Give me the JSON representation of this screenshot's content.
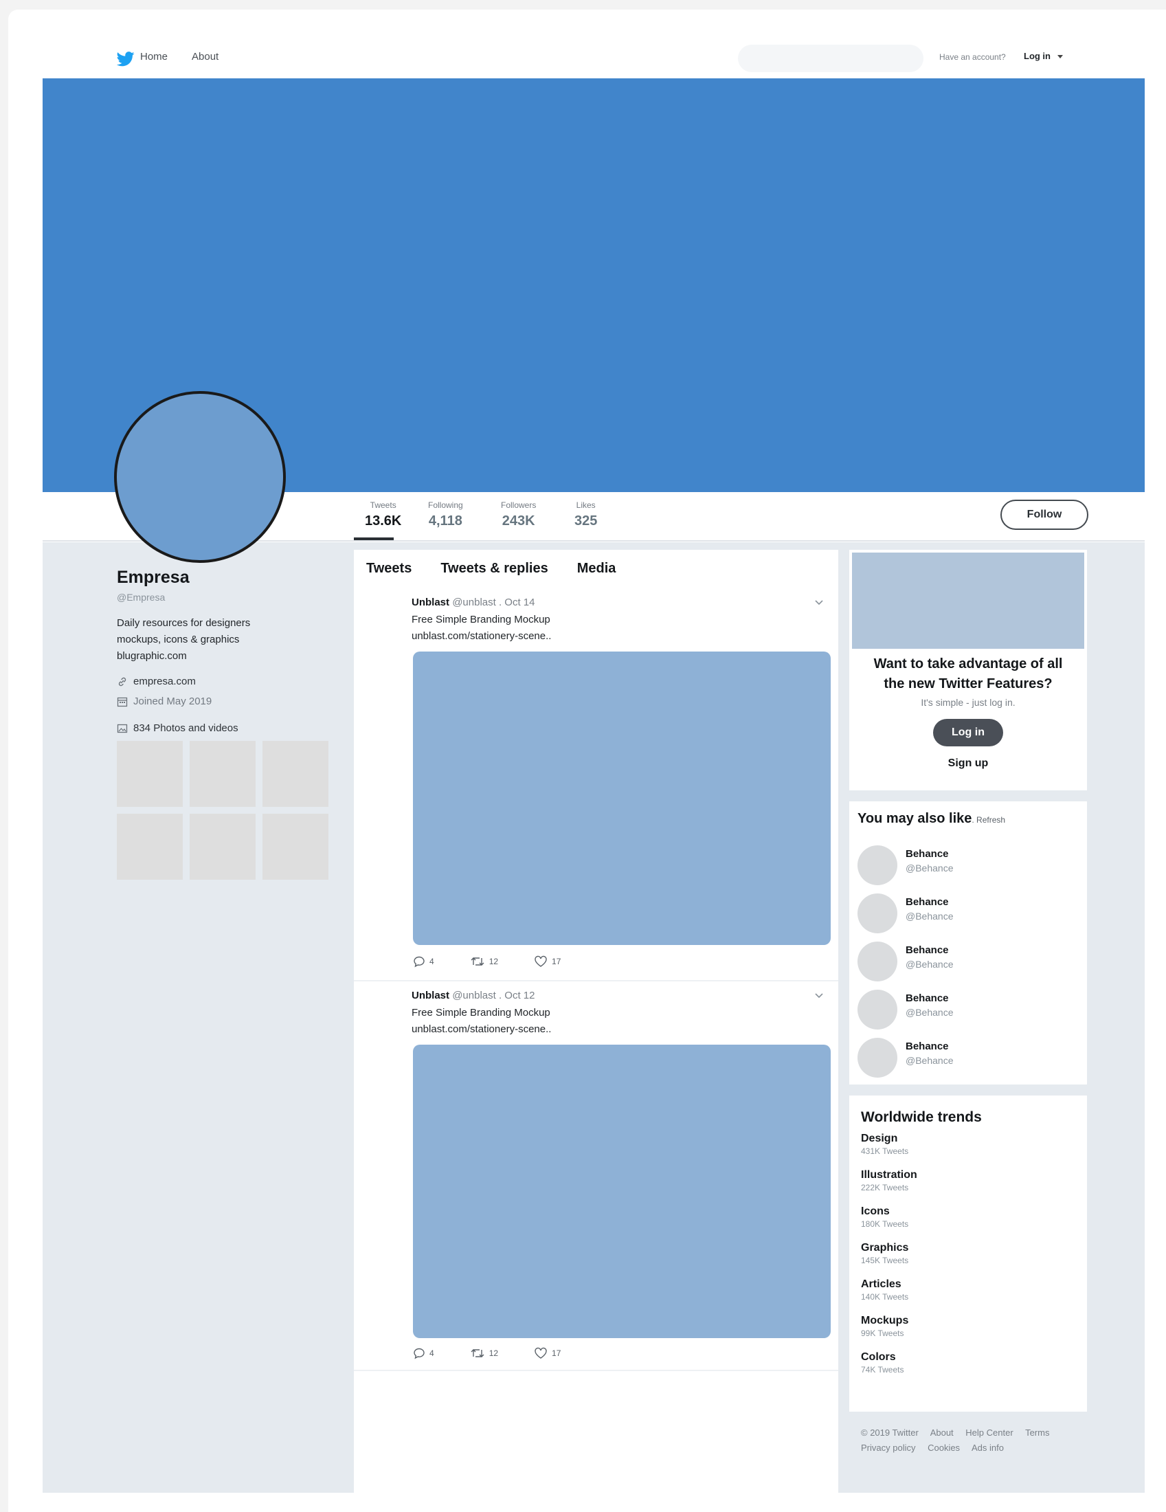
{
  "nav": {
    "home": "Home",
    "about": "About",
    "have_account": "Have an account?",
    "login": "Log in"
  },
  "profile": {
    "name": "Empresa",
    "handle": "@Empresa",
    "bio": [
      "Daily resources for designers",
      "mockups, icons & graphics",
      "blugraphic.com"
    ],
    "website": "empresa.com",
    "joined": "Joined May 2019",
    "photos": "834 Photos and videos"
  },
  "stats": [
    {
      "label": "Tweets",
      "value": "13.6K"
    },
    {
      "label": "Following",
      "value": "4,118"
    },
    {
      "label": "Followers",
      "value": "243K"
    },
    {
      "label": "Likes",
      "value": "325"
    }
  ],
  "follow_label": "Follow",
  "tabs": [
    "Tweets",
    "Tweets & replies",
    "Media"
  ],
  "tweets": [
    {
      "author": "Unblast",
      "meta": "@unblast . Oct 14",
      "text": "Free Simple Branding Mockup",
      "link": "unblast.com/stationery-scene..",
      "replies": "4",
      "retweets": "12",
      "likes": "17"
    },
    {
      "author": "Unblast",
      "meta": "@unblast . Oct 12",
      "text": "Free Simple Branding Mockup",
      "link": "unblast.com/stationery-scene..",
      "replies": "4",
      "retweets": "12",
      "likes": "17"
    }
  ],
  "login_card": {
    "title_line1": "Want to take advantage of all",
    "title_line2": "the new Twitter Features?",
    "subtitle": "It's simple - just log in.",
    "login": "Log in",
    "signup": "Sign up"
  },
  "suggestions": {
    "title": "You may also like",
    "refresh": ". Refresh",
    "items": [
      {
        "name": "Behance",
        "handle": "@Behance"
      },
      {
        "name": "Behance",
        "handle": "@Behance"
      },
      {
        "name": "Behance",
        "handle": "@Behance"
      },
      {
        "name": "Behance",
        "handle": "@Behance"
      },
      {
        "name": "Behance",
        "handle": "@Behance"
      }
    ]
  },
  "trends": {
    "title": "Worldwide trends",
    "items": [
      {
        "name": "Design",
        "count": "431K Tweets"
      },
      {
        "name": "Illustration",
        "count": "222K Tweets"
      },
      {
        "name": "Icons",
        "count": "180K Tweets"
      },
      {
        "name": "Graphics",
        "count": "145K Tweets"
      },
      {
        "name": "Articles",
        "count": "140K Tweets"
      },
      {
        "name": "Mockups",
        "count": "99K Tweets"
      },
      {
        "name": "Colors",
        "count": "74K Tweets"
      }
    ]
  },
  "footer": {
    "copyright": "© 2019 Twitter",
    "about": "About",
    "help": "Help Center",
    "terms": "Terms",
    "privacy": "Privacy policy",
    "cookies": "Cookies",
    "ads": "Ads info"
  },
  "colors": {
    "banner": "#4185cb",
    "avatar": "#6d9dcf",
    "media": "#8eb1d6",
    "twitter_blue": "#1da1f2"
  },
  "icons": {
    "logo": "twitter-bird-icon",
    "link": "link-icon",
    "calendar": "calendar-icon",
    "photos": "image-icon",
    "reply": "reply-icon",
    "retweet": "retweet-icon",
    "like": "heart-icon",
    "more": "chevron-down-icon"
  }
}
